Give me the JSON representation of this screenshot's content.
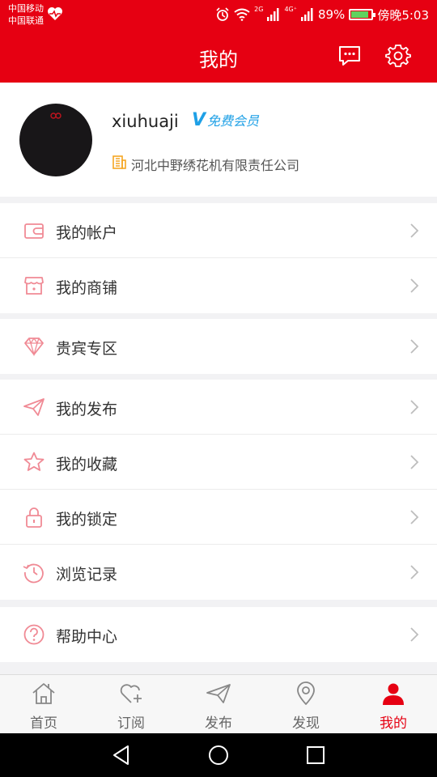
{
  "status_bar": {
    "carrier_1": "中国移动",
    "carrier_2": "中国联通",
    "net_2g": "2G",
    "net_4g": "4G⁺",
    "battery": "89%",
    "time": "傍晚5:03",
    "battery_level": 0.89
  },
  "header": {
    "title": "我的",
    "message_icon": "message-icon",
    "settings_icon": "gear-icon"
  },
  "profile": {
    "username": "xiuhuaji",
    "vip_v": "V",
    "vip_label": "免费会员",
    "company": "河北中野绣花机有限责任公司"
  },
  "menu_groups": [
    [
      {
        "label": "我的帐户",
        "icon": "wallet-icon"
      },
      {
        "label": "我的商铺",
        "icon": "store-icon"
      }
    ],
    [
      {
        "label": "贵宾专区",
        "icon": "diamond-icon"
      }
    ],
    [
      {
        "label": "我的发布",
        "icon": "paper-plane-icon"
      },
      {
        "label": "我的收藏",
        "icon": "star-icon"
      },
      {
        "label": "我的锁定",
        "icon": "lock-icon"
      },
      {
        "label": "浏览记录",
        "icon": "history-icon"
      }
    ],
    [
      {
        "label": "帮助中心",
        "icon": "help-icon"
      }
    ]
  ],
  "tabbar": [
    {
      "label": "首页",
      "icon": "home-icon",
      "active": false
    },
    {
      "label": "订阅",
      "icon": "subscribe-icon",
      "active": false
    },
    {
      "label": "发布",
      "icon": "publish-icon",
      "active": false
    },
    {
      "label": "发现",
      "icon": "location-icon",
      "active": false
    },
    {
      "label": "我的",
      "icon": "user-icon",
      "active": true
    }
  ],
  "colors": {
    "brand": "#e60012",
    "icon_pink": "#f08a95",
    "vip_blue": "#1ea0e6",
    "company_icon": "#f5a623"
  }
}
